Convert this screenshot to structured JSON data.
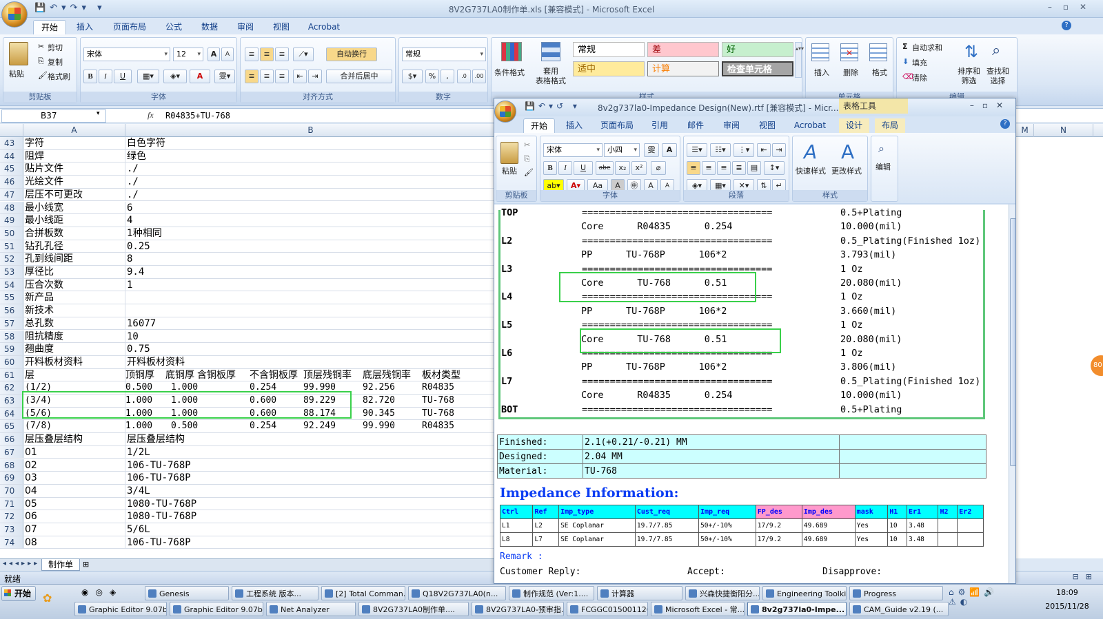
{
  "excel": {
    "title": "8V2G737LA0制作单.xls  [兼容模式] - Microsoft Excel",
    "tabs": [
      "开始",
      "插入",
      "页面布局",
      "公式",
      "数据",
      "审阅",
      "视图",
      "Acrobat"
    ],
    "groups": {
      "clipboard": "剪贴板",
      "font": "字体",
      "align": "对齐方式",
      "number": "数字",
      "style": "样式",
      "cells": "单元格",
      "edit": "编辑"
    },
    "clip": {
      "paste": "粘贴",
      "cut": "剪切",
      "copy": "复制",
      "format": "格式刷"
    },
    "font": {
      "name": "宋体",
      "size": "12",
      "bold": "B",
      "italic": "I",
      "underline": "U",
      "grow": "A",
      "shrink": "A",
      "color": "A"
    },
    "align": {
      "wrap": "自动换行",
      "merge": "合并后居中"
    },
    "number": {
      "format": "常规",
      "percent": "%",
      "comma": ","
    },
    "styles": {
      "cond": "条件格式",
      "table": "套用\n表格格式",
      "normal": "常规",
      "bad": "差",
      "good": "好",
      "neutral": "适中",
      "calc": "计算",
      "check": "检查单元格"
    },
    "cells": {
      "insert": "插入",
      "delete": "删除",
      "format": "格式"
    },
    "edit": {
      "autosum": "自动求和",
      "fill": "填充",
      "clear": "清除",
      "sort": "排序和\n筛选",
      "find": "查找和\n选择"
    },
    "namebox": "B37",
    "fx": "fx",
    "formula": "R04835+TU-768",
    "col_headers": [
      "A",
      "B",
      "M",
      "N"
    ],
    "rows": [
      {
        "n": "43",
        "a": "字符",
        "b": "白色字符"
      },
      {
        "n": "44",
        "a": "阻焊",
        "b": "绿色"
      },
      {
        "n": "45",
        "a": "贴片文件",
        "b": "./"
      },
      {
        "n": "46",
        "a": "光绘文件",
        "b": "./"
      },
      {
        "n": "47",
        "a": "层压不可更改",
        "b": "./"
      },
      {
        "n": "48",
        "a": "最小线宽",
        "b": "6"
      },
      {
        "n": "49",
        "a": "最小线距",
        "b": "4"
      },
      {
        "n": "50",
        "a": "合拼板数",
        "b": "1种相同"
      },
      {
        "n": "51",
        "a": "钻孔孔径",
        "b": "0.25"
      },
      {
        "n": "52",
        "a": "孔到线间距",
        "b": "8"
      },
      {
        "n": "53",
        "a": "厚径比",
        "b": "9.4"
      },
      {
        "n": "54",
        "a": "压合次数",
        "b": "1"
      },
      {
        "n": "55",
        "a": "新产品",
        "b": ""
      },
      {
        "n": "56",
        "a": "新技术",
        "b": ""
      },
      {
        "n": "57",
        "a": "总孔数",
        "b": "16077"
      },
      {
        "n": "58",
        "a": "阻抗精度",
        "b": "10"
      },
      {
        "n": "59",
        "a": "翘曲度",
        "b": "0.75"
      },
      {
        "n": "60",
        "a": "开料板材资料",
        "b": "开料板材资料"
      }
    ],
    "header_row": {
      "n": "61",
      "a": "层",
      "cols": [
        "顶铜厚",
        "底铜厚",
        "含铜板厚",
        "不含铜板厚",
        "顶层残铜率",
        "底层残铜率",
        "板材类型"
      ]
    },
    "layer_rows": [
      {
        "n": "62",
        "a": "(1/2)",
        "cols": [
          "0.500",
          "1.000",
          "",
          "0.254",
          "99.990",
          "92.256",
          "R04835"
        ]
      },
      {
        "n": "63",
        "a": "(3/4)",
        "cols": [
          "1.000",
          "1.000",
          "",
          "0.600",
          "89.229",
          "82.720",
          "TU-768"
        ]
      },
      {
        "n": "64",
        "a": "(5/6)",
        "cols": [
          "1.000",
          "1.000",
          "",
          "0.600",
          "88.174",
          "90.345",
          "TU-768"
        ]
      },
      {
        "n": "65",
        "a": "(7/8)",
        "cols": [
          "1.000",
          "0.500",
          "",
          "0.254",
          "92.249",
          "99.990",
          "R04835"
        ]
      }
    ],
    "rows2": [
      {
        "n": "66",
        "a": "层压叠层结构",
        "b": "层压叠层结构"
      },
      {
        "n": "67",
        "a": "01",
        "b": "1/2L"
      },
      {
        "n": "68",
        "a": "02",
        "b": "106-TU-768P"
      },
      {
        "n": "69",
        "a": "03",
        "b": "106-TU-768P"
      },
      {
        "n": "70",
        "a": "04",
        "b": "3/4L"
      },
      {
        "n": "71",
        "a": "05",
        "b": "1080-TU-768P"
      },
      {
        "n": "72",
        "a": "06",
        "b": "1080-TU-768P"
      },
      {
        "n": "73",
        "a": "07",
        "b": "5/6L"
      },
      {
        "n": "74",
        "a": "08",
        "b": "106-TU-768P"
      }
    ],
    "sheet_tab": "制作单",
    "status": "就绪"
  },
  "word": {
    "title": "8v2g737la0-Impedance Design(New).rtf [兼容模式] - Micr...",
    "context_tab": "表格工具",
    "tabs": [
      "开始",
      "插入",
      "页面布局",
      "引用",
      "邮件",
      "审阅",
      "视图",
      "Acrobat",
      "设计",
      "布局"
    ],
    "groups": {
      "clip": "剪贴板",
      "font": "字体",
      "para": "段落",
      "style": "样式"
    },
    "font": {
      "name": "宋体",
      "size": "小四",
      "bold": "B",
      "italic": "I",
      "underline": "U",
      "strike": "abe",
      "sub": "x₂",
      "sup": "x²",
      "case": "Aa"
    },
    "clip": {
      "paste": "粘贴"
    },
    "style": {
      "quick": "快速样式",
      "change": "更改样式",
      "edit": "编辑"
    },
    "stack": [
      {
        "l": "TOP",
        "m": "        ==================================",
        "r": "0.5+Plating"
      },
      {
        "l": "",
        "m": "Core      R04835      0.254",
        "r": "10.000(mil)"
      },
      {
        "l": "L2",
        "m": "        ==================================",
        "r": "0.5_Plating(Finished 1oz)"
      },
      {
        "l": "",
        "m": "PP      TU-768P      106*2",
        "r": "3.793(mil)"
      },
      {
        "l": "L3",
        "m": "        ==================================",
        "r": "1 Oz"
      },
      {
        "l": "",
        "m": "Core      TU-768      0.51",
        "r": "20.080(mil)"
      },
      {
        "l": "L4",
        "m": "        ==================================",
        "r": "1 Oz"
      },
      {
        "l": "",
        "m": "PP      TU-768P      106*2",
        "r": "3.660(mil)"
      },
      {
        "l": "L5",
        "m": "        ==================================",
        "r": "1 Oz"
      },
      {
        "l": "",
        "m": "Core      TU-768      0.51",
        "r": "20.080(mil)"
      },
      {
        "l": "L6",
        "m": "        ==================================",
        "r": "1 Oz"
      },
      {
        "l": "",
        "m": "PP      TU-768P      106*2",
        "r": "3.806(mil)"
      },
      {
        "l": "L7",
        "m": "        ==================================",
        "r": "0.5_Plating(Finished 1oz)"
      },
      {
        "l": "",
        "m": "Core      R04835      0.254",
        "r": "10.000(mil)"
      },
      {
        "l": "BOT",
        "m": "        ==================================",
        "r": "0.5+Plating"
      }
    ],
    "finish": [
      {
        "k": "Finished:",
        "v": "2.1(+0.21/-0.21) MM"
      },
      {
        "k": "Designed:",
        "v": "2.04 MM"
      },
      {
        "k": "Material:",
        "v": "TU-768"
      }
    ],
    "imp_title": "Impedance Information:",
    "imp_headers": [
      "Ctrl",
      "Ref",
      "Imp_type",
      "Cust_req",
      "Imp_req",
      "FP_des",
      "Imp_des",
      "mask",
      "H1",
      "Er1",
      "H2",
      "Er2"
    ],
    "imp_rows": [
      [
        "L1",
        "L2",
        "SE Coplanar",
        "19.7/7.85",
        "50+/-10%",
        "17/9.2",
        "49.689",
        "Yes",
        "10",
        "3.48",
        "",
        ""
      ],
      [
        "L8",
        "L7",
        "SE Coplanar",
        "19.7/7.85",
        "50+/-10%",
        "17/9.2",
        "49.689",
        "Yes",
        "10",
        "3.48",
        "",
        ""
      ]
    ],
    "remark": "Remark :",
    "reply": "Customer Reply:",
    "accept": "Accept:",
    "disapprove": "Disapprove:"
  },
  "taskbar": {
    "start": "开始",
    "top": [
      "Genesis",
      "工程系统  版本...",
      "[2] Total Comman...",
      "Q18V2G737LA0(n...",
      "制作规范 (Ver:1....",
      "计算器",
      "兴森快捷衡阳分...",
      "Engineering Toolki...",
      "Progress"
    ],
    "bottom": [
      "Graphic Editor 9.07b...",
      "Graphic Editor 9.07b...",
      "Net Analyzer",
      "8V2G737LA0制作单....",
      "8V2G737LA0-预审指...",
      "FCGGC015001126-2...",
      "Microsoft Excel - 常...",
      "8v2g737la0-Impe...",
      "CAM_Guide v2.19 (..."
    ],
    "time": "18:09",
    "date": "2015/11/28"
  },
  "side_badge": "80"
}
